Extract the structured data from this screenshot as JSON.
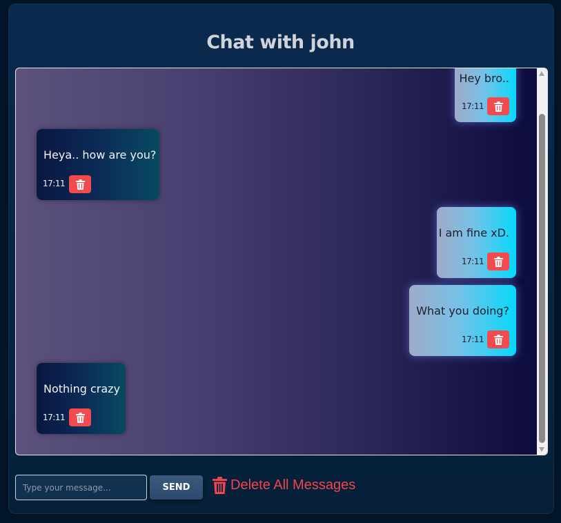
{
  "title": "Chat with john",
  "messages": [
    {
      "text": "Hey bro..",
      "time": "17:11",
      "side": "sent"
    },
    {
      "text": "Heya.. how are you?",
      "time": "17:11",
      "side": "received"
    },
    {
      "text": "I am fine xD.",
      "time": "17:11",
      "side": "sent"
    },
    {
      "text": "What you doing?",
      "time": "17:11",
      "side": "sent"
    },
    {
      "text": "Nothing crazy",
      "time": "17:11",
      "side": "received"
    }
  ],
  "composer": {
    "placeholder": "Type your message...",
    "value": "",
    "send_label": "SEND",
    "delete_all_label": "Delete All Messages"
  },
  "icons": {
    "message_delete": "trash-icon",
    "delete_all": "trash-icon"
  },
  "colors": {
    "delete_red": "#f24a4d",
    "sent_bubble_end": "#06d9fc",
    "received_bubble_start": "#091741"
  }
}
